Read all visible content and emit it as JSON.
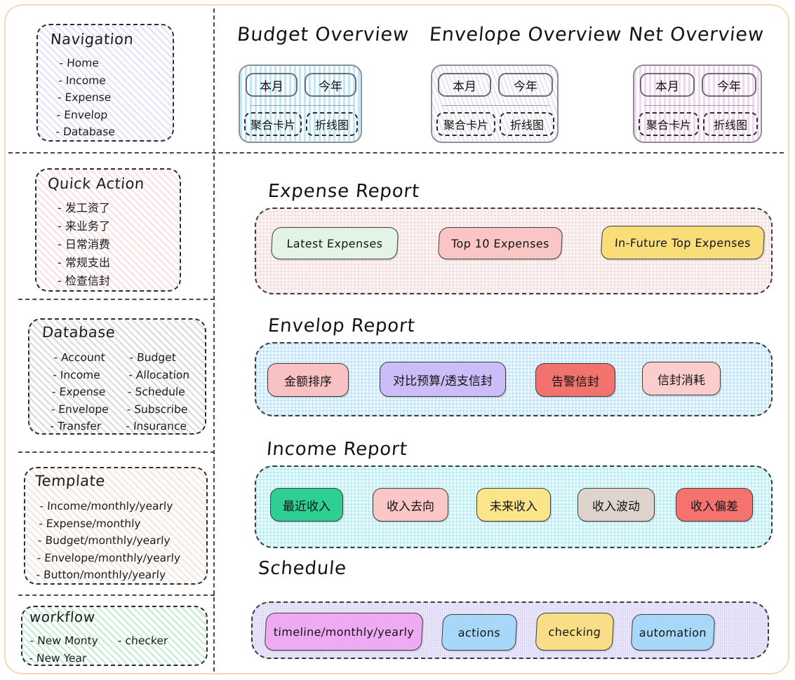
{
  "sidebar": {
    "navigation": {
      "title": "Navigation",
      "items": [
        "- Home",
        "- Income",
        "- Expense",
        "- Envelop",
        "- Database"
      ]
    },
    "quick_action": {
      "title": "Quick Action",
      "items": [
        "- 发工资了",
        "- 来业务了",
        "- 日常消费",
        "- 常规支出",
        "- 检查信封"
      ]
    },
    "database": {
      "title": "Database",
      "col1": [
        "- Account",
        "- Income",
        "- Expense",
        "- Envelope",
        "- Transfer"
      ],
      "col2": [
        "- Budget",
        "- Allocation",
        "- Schedule",
        "- Subscribe",
        "- Insurance"
      ]
    },
    "template": {
      "title": "Template",
      "items": [
        "- Income/monthly/yearly",
        "- Expense/monthly",
        "- Budget/monthly/yearly",
        "- Envelope/monthly/yearly",
        "- Button/monthly/yearly"
      ]
    },
    "workflow": {
      "title": "workflow",
      "col1": [
        "- New Monty",
        "- New Year"
      ],
      "col2": [
        "- checker"
      ]
    }
  },
  "overviews": [
    {
      "title": "Budget Overview",
      "range_buttons": [
        "本月",
        "今年"
      ],
      "view_buttons": [
        "聚合卡片",
        "折线图"
      ]
    },
    {
      "title": "Envelope Overview",
      "range_buttons": [
        "本月",
        "今年"
      ],
      "view_buttons": [
        "聚合卡片",
        "折线图"
      ]
    },
    {
      "title": "Net Overview",
      "range_buttons": [
        "本月",
        "今年"
      ],
      "view_buttons": [
        "聚合卡片",
        "折线图"
      ]
    }
  ],
  "reports": {
    "expense": {
      "title": "Expense Report",
      "pills": [
        {
          "label": "Latest Expenses",
          "color": "#e3f3e5"
        },
        {
          "label": "Top 10  Expenses",
          "color": "#f9c5c5"
        },
        {
          "label": "In-Future Top  Expenses",
          "color": "#f9dd78"
        }
      ]
    },
    "envelop": {
      "title": "Envelop Report",
      "pills": [
        {
          "label": "金额排序",
          "color": "#f9c2c2"
        },
        {
          "label": "对比预算/透支信封",
          "color": "#cbbdf7"
        },
        {
          "label": "告警信封",
          "color": "#f2726d"
        },
        {
          "label": "信封消耗",
          "color": "#fbcdcd"
        }
      ]
    },
    "income": {
      "title": "Income Report",
      "pills": [
        {
          "label": "最近收入",
          "color": "#2dcf92"
        },
        {
          "label": "收入去向",
          "color": "#fac6c6"
        },
        {
          "label": "未来收入",
          "color": "#fae58a"
        },
        {
          "label": "收入波动",
          "color": "#ded4cd"
        },
        {
          "label": "收入偏差",
          "color": "#f4736e"
        }
      ]
    },
    "schedule": {
      "title": "Schedule",
      "pills": [
        {
          "label": "timeline/monthly/yearly",
          "color": "#eeaaf2"
        },
        {
          "label": "actions",
          "color": "#a7d8f7"
        },
        {
          "label": "checking",
          "color": "#f9dd87"
        },
        {
          "label": "automation",
          "color": "#a7d8f7"
        }
      ]
    }
  }
}
